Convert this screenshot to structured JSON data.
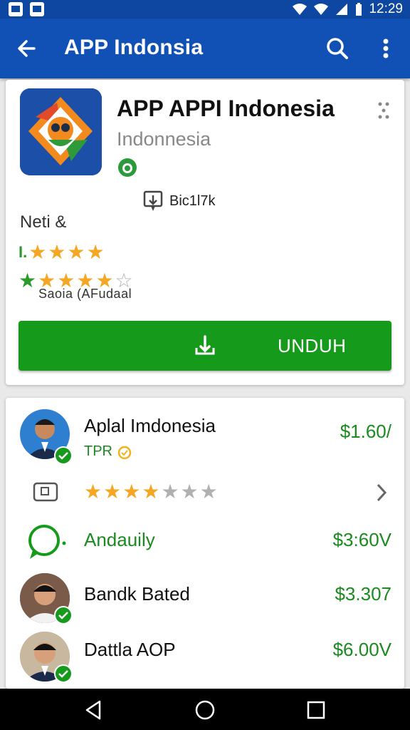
{
  "status_bar": {
    "time": "12:29"
  },
  "app_bar": {
    "title": "APP Indonsia"
  },
  "app": {
    "name": "APP APPI Indonesia",
    "developer": "Indonnesia",
    "downloads": "Bic1l7k",
    "rating_label": "Neti &",
    "rating_prefix": "I.",
    "rating_caption": "Saoia  (AFudaal",
    "install_label": "UNDUH",
    "accent_color": "#169a1c"
  },
  "list": [
    {
      "title": "Aplal Imdonesia",
      "subtitle": "TPR",
      "price": "$1.60/",
      "icon": "avatar"
    },
    {
      "icon": "camera-icon",
      "rating_stars": 4,
      "max_stars": 7
    },
    {
      "title": "Andauily",
      "price": "$3:60V",
      "icon": "chat-icon"
    },
    {
      "title": "Bandk Bated",
      "price": "$3.307",
      "icon": "avatar"
    },
    {
      "title": "Dattla AOP",
      "price": "$6.00V",
      "icon": "avatar"
    }
  ]
}
